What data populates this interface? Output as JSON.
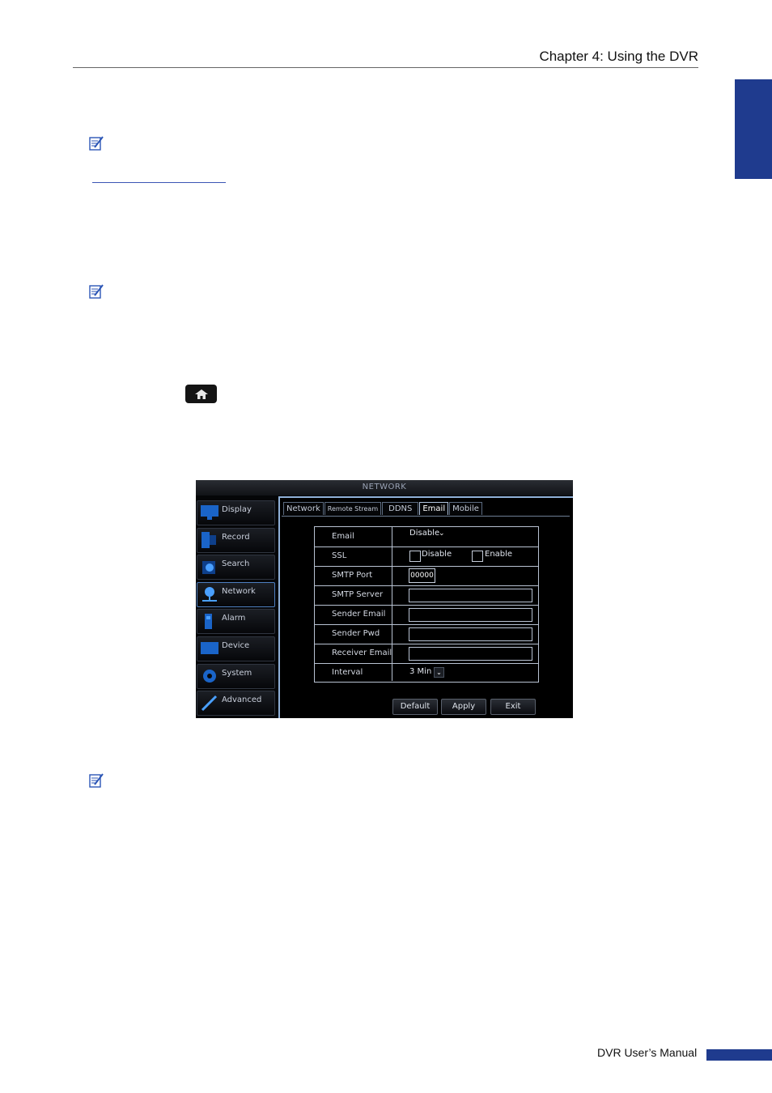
{
  "header": {
    "chapter_title": "Chapter 4: Using the DVR"
  },
  "dvr_window": {
    "title": "NETWORK",
    "menu": [
      {
        "label": "Display",
        "icon": "monitor-icon"
      },
      {
        "label": "Record",
        "icon": "record-icon"
      },
      {
        "label": "Search",
        "icon": "search-icon"
      },
      {
        "label": "Network",
        "icon": "network-icon"
      },
      {
        "label": "Alarm",
        "icon": "alarm-icon"
      },
      {
        "label": "Device",
        "icon": "device-icon"
      },
      {
        "label": "System",
        "icon": "gear-icon"
      },
      {
        "label": "Advanced",
        "icon": "wrench-icon"
      }
    ],
    "tabs": [
      "Network",
      "Remote Stream",
      "DDNS",
      "Email",
      "Mobile"
    ],
    "form": {
      "email_label": "Email",
      "email_value": "Disable",
      "ssl_label": "SSL",
      "ssl_disable": "Disable",
      "ssl_enable": "Enable",
      "smtp_port_label": "SMTP Port",
      "smtp_port_value": "00000",
      "smtp_server_label": "SMTP Server",
      "sender_email_label": "Sender Email",
      "sender_pwd_label": "Sender Pwd",
      "receiver_email_label": "Receiver Email",
      "interval_label": "Interval",
      "interval_value": "3 Min"
    },
    "buttons": {
      "default": "Default",
      "apply": "Apply",
      "exit": "Exit"
    }
  },
  "footer": {
    "manual_title": "DVR User’s Manual"
  },
  "colors": {
    "accent": "#1f3b8e",
    "link": "#3b55b5",
    "dvr_active": "#4e7fc0"
  }
}
